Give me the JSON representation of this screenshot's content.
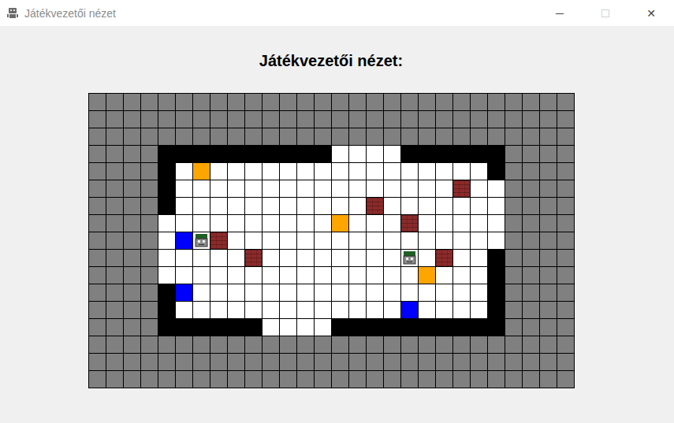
{
  "window": {
    "title": "Játékvezetői nézet",
    "controls": [
      {
        "glyph": "─",
        "disabled": false
      },
      {
        "glyph": "☐",
        "disabled": true
      },
      {
        "glyph": "✕",
        "disabled": false
      }
    ]
  },
  "heading": "Játékvezetői nézet:",
  "board": {
    "legend": [
      {
        "char": "G",
        "kind": "void",
        "color": "#808080"
      },
      {
        "char": "B",
        "kind": "wall",
        "color": "#000000"
      },
      {
        "char": "W",
        "kind": "floor",
        "color": "#ffffff"
      },
      {
        "char": "O",
        "kind": "goal",
        "color": "#ffa500"
      },
      {
        "char": "U",
        "kind": "exit",
        "color": "#0000ff"
      },
      {
        "char": "R",
        "kind": "brick",
        "color": "#8b2a2a"
      },
      {
        "char": "T",
        "kind": "robot",
        "color": "#ffffff"
      }
    ],
    "rows": [
      "GGGGGGGGGGGGGGGGGGGGGGGGGGGG",
      "GGGGGGGGGGGGGGGGGGGGGGGGGGGG",
      "GGGGGGGGGGGGGGGGGGGGGGGGGGGG",
      "GGGGBBBBBBBBBBWWWWBBBBBBGGGG",
      "GGGGBWOWWWWWWWWWWWWWWWWBGGGG",
      "GGGGBWWWWWWWWWWWWWWWWRWWGGGG",
      "GGGGBWWWWWWWWWWWRWWWWWWWGGGG",
      "GGGGWWWWWWWWWWOWWWRWWWWWGGGG",
      "GGGGWUTRWWWWWWWWWWWWWWWWGGGG",
      "GGGGWWWWWRWWWWWWWWTWRWWBGGGG",
      "GGGGWWWWWWWWWWWWWWWOWWWBGGGG",
      "GGGGBUWWWWWWWWWWWWWWWWWBGGGG",
      "GGGGBWWWWWWWWWWWWWUWWWWBGGGG",
      "GGGGBBBBBBWWWWBBBBBBBBBBGGGG",
      "GGGGGGGGGGGGGGGGGGGGGGGGGGGG",
      "GGGGGGGGGGGGGGGGGGGGGGGGGGGG",
      "GGGGGGGGGGGGGGGGGGGGGGGGGGGG"
    ]
  }
}
